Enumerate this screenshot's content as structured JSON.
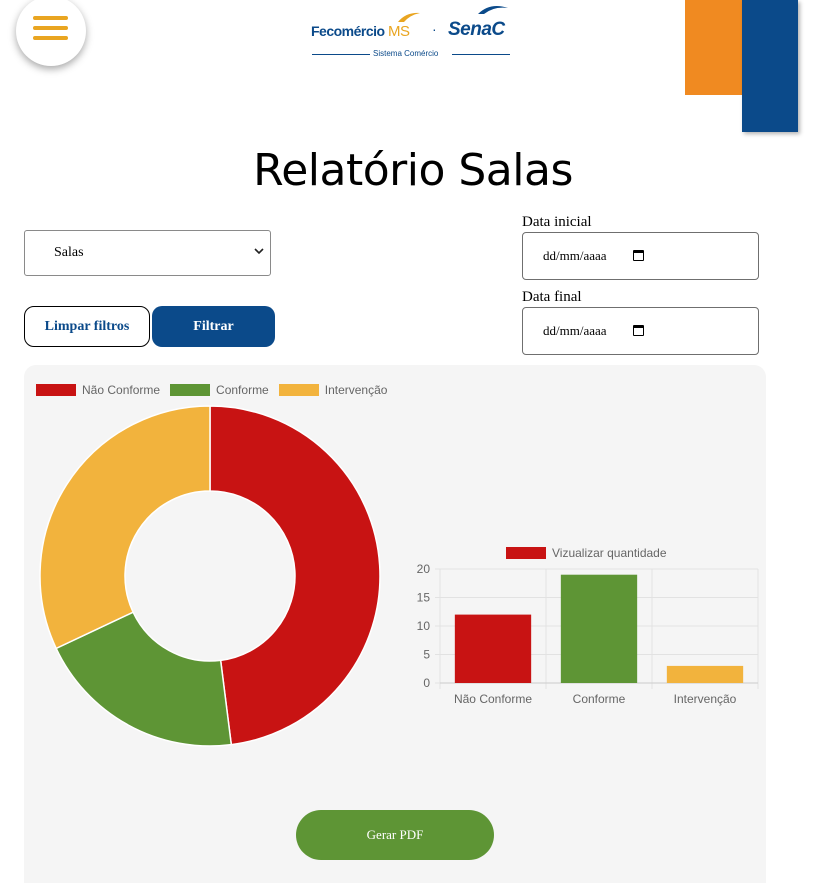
{
  "logo": {
    "brand_fecomercio": "Fecomércio",
    "brand_ms": "MS",
    "separator": "·",
    "brand_senac": "SenaC",
    "tagline": "Sistema Comércio"
  },
  "page_title": "Relatório Salas",
  "filters": {
    "room_select_value": "Salas",
    "clear_label": "Limpar filtros",
    "filter_label": "Filtrar",
    "start_date_label": "Data inicial",
    "start_date_placeholder": "dd/mm/aaaa",
    "end_date_label": "Data final",
    "end_date_placeholder": "dd/mm/aaaa"
  },
  "colors": {
    "nao_conforme": "#c81313",
    "conforme": "#5e9535",
    "intervencao": "#f2b33d",
    "brand_blue": "#0b4a8a",
    "brand_orange": "#f08a21"
  },
  "chart_data": [
    {
      "type": "pie",
      "variant": "doughnut",
      "categories": [
        "Não Conforme",
        "Conforme",
        "Intervenção"
      ],
      "values": [
        12,
        5,
        8
      ],
      "colors": [
        "#c81313",
        "#5e9535",
        "#f2b33d"
      ],
      "legend": [
        "Não Conforme",
        "Conforme",
        "Intervenção"
      ],
      "legend_position": "top-left"
    },
    {
      "type": "bar",
      "categories": [
        "Não Conforme",
        "Conforme",
        "Intervenção"
      ],
      "series": [
        {
          "name": "Vizualizar quantidade",
          "values": [
            12,
            19,
            3
          ]
        }
      ],
      "colors": [
        "#c81313",
        "#5e9535",
        "#f2b33d"
      ],
      "ylim": [
        0,
        20
      ],
      "yticks": [
        "20",
        "15",
        "10",
        "5",
        "0"
      ],
      "grid": true,
      "legend_position": "top"
    }
  ],
  "pdf_button_label": "Gerar PDF"
}
